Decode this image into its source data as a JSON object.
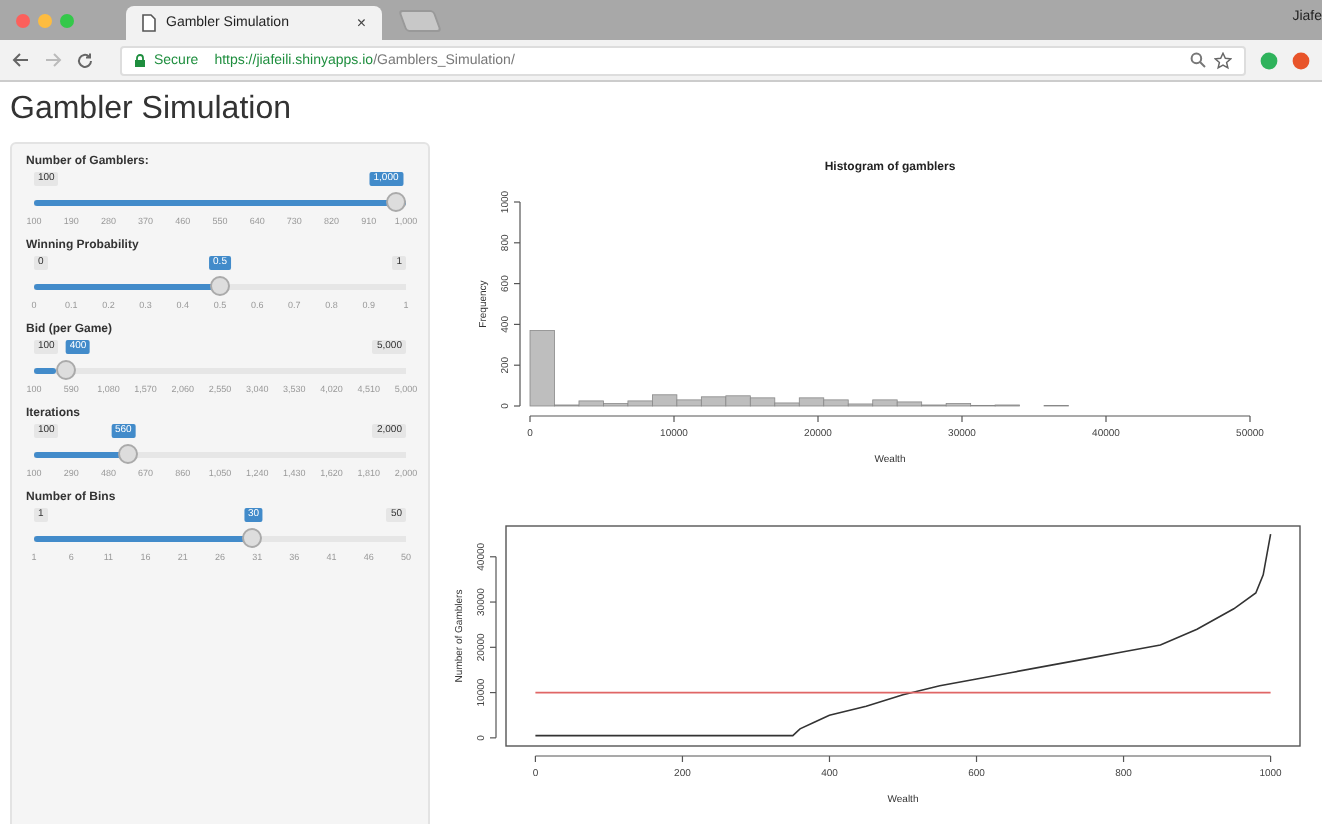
{
  "browser": {
    "tab_title": "Gambler Simulation",
    "tab_close": "×",
    "profile": "Jiafe",
    "secure_label": "Secure",
    "url_host": "https://jiafeili.shinyapps.io",
    "url_path": "/Gamblers_Simulation/"
  },
  "page_title": "Gambler Simulation",
  "sliders": [
    {
      "label": "Number of Gamblers:",
      "min": "100",
      "value": "1,000",
      "level": 1,
      "ticks": [
        "100",
        "190",
        "280",
        "370",
        "460",
        "550",
        "640",
        "730",
        "820",
        "910",
        "1,000"
      ]
    },
    {
      "label": "Winning Probability",
      "min": "0",
      "max": "1",
      "value": "0.5",
      "level": 0.5,
      "ticks": [
        "0",
        "0.1",
        "0.2",
        "0.3",
        "0.4",
        "0.5",
        "0.6",
        "0.7",
        "0.8",
        "0.9",
        "1"
      ]
    },
    {
      "label": "Bid (per Game)",
      "min": "100",
      "max": "5,000",
      "value": "400",
      "level": 0.06,
      "ticks": [
        "100",
        "590",
        "1,080",
        "1,570",
        "2,060",
        "2,550",
        "3,040",
        "3,530",
        "4,020",
        "4,510",
        "5,000"
      ]
    },
    {
      "label": "Iterations",
      "min": "100",
      "max": "2,000",
      "value": "560",
      "level": 0.24,
      "ticks": [
        "100",
        "290",
        "480",
        "670",
        "860",
        "1,050",
        "1,240",
        "1,430",
        "1,620",
        "1,810",
        "2,000"
      ]
    },
    {
      "label": "Number of Bins",
      "min": "1",
      "max": "50",
      "value": "30",
      "level": 0.59,
      "ticks": [
        "1",
        "6",
        "11",
        "16",
        "21",
        "26",
        "31",
        "36",
        "41",
        "46",
        "50"
      ]
    }
  ],
  "charts": [
    {
      "chart_data": {
        "type": "bar",
        "title": "Histogram of gamblers",
        "xlabel": "Wealth",
        "ylabel": "Frequency",
        "x": [
          850,
          2550,
          4250,
          5950,
          7650,
          9350,
          11050,
          12750,
          14450,
          16150,
          17850,
          19550,
          21250,
          22950,
          24650,
          26350,
          28050,
          29750,
          31450,
          33150,
          34850,
          36550
        ],
        "values": [
          370,
          5,
          25,
          12,
          25,
          55,
          30,
          45,
          50,
          40,
          15,
          40,
          30,
          10,
          30,
          20,
          5,
          12,
          3,
          5,
          0,
          2
        ],
        "xlim": [
          0,
          50000
        ],
        "ylim": [
          0,
          1000
        ],
        "xticks": [
          0,
          10000,
          20000,
          30000,
          40000,
          50000
        ],
        "yticks": [
          0,
          200,
          400,
          600,
          800,
          1000
        ]
      }
    },
    {
      "chart_data": {
        "type": "line",
        "xlabel": "Wealth",
        "ylabel": "Number of Gamblers",
        "x": [
          0,
          350,
          360,
          380,
          400,
          450,
          500,
          550,
          600,
          650,
          700,
          750,
          800,
          850,
          900,
          950,
          980,
          990,
          1000
        ],
        "series": [
          {
            "color": "#333333",
            "values": [
              500,
              500,
              2000,
              3500,
              5000,
              7000,
              9500,
              11500,
              13000,
              14500,
              16000,
              17500,
              19000,
              20500,
              24000,
              28500,
              32000,
              36000,
              45000
            ]
          },
          {
            "color": "#e06666",
            "values": [
              10000,
              10000,
              10000,
              10000,
              10000,
              10000,
              10000,
              10000,
              10000,
              10000,
              10000,
              10000,
              10000,
              10000,
              10000,
              10000,
              10000,
              10000,
              10000
            ]
          }
        ],
        "xlim": [
          -40,
          1040
        ],
        "ylim": [
          -1800,
          46800
        ],
        "xticks": [
          0,
          200,
          400,
          600,
          800,
          1000
        ],
        "yticks": [
          0,
          10000,
          20000,
          30000,
          40000
        ]
      }
    }
  ]
}
